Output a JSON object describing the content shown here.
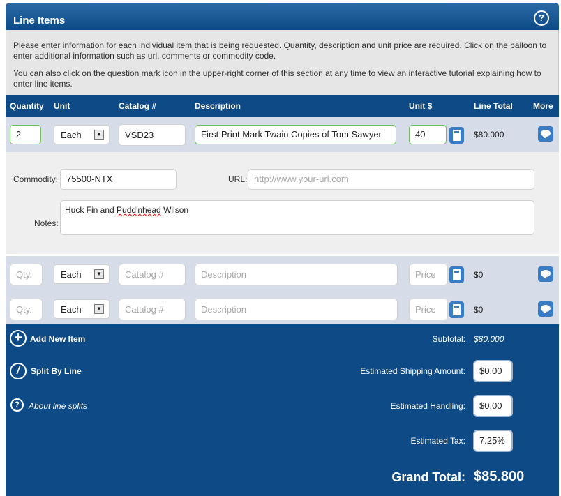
{
  "header": {
    "title": "Line Items",
    "help_icon": "?"
  },
  "intro": {
    "line1": "Please enter information for each individual item that is being requested. Quantity, description and unit price are required. Click on the balloon to enter additional information such as url, comments or commodity code.",
    "line2": "You can also click on the question mark icon in the upper-right corner of this section at any time to view an interactive tutorial explaining how to enter line items."
  },
  "columns": {
    "quantity": "Quantity",
    "unit": "Unit",
    "catalog": "Catalog #",
    "description": "Description",
    "unit_price": "Unit $",
    "line_total": "Line Total",
    "more": "More"
  },
  "items": [
    {
      "quantity": "2",
      "unit": "Each",
      "catalog": "VSD23",
      "description": "First Print Mark Twain Copies of Tom Sawyer",
      "price": "40",
      "line_total": "$80.000"
    },
    {
      "quantity": "",
      "unit": "Each",
      "catalog": "",
      "description": "",
      "price": "",
      "line_total": "$0"
    },
    {
      "quantity": "",
      "unit": "Each",
      "catalog": "",
      "description": "",
      "price": "",
      "line_total": "$0"
    }
  ],
  "placeholders": {
    "quantity": "Qty.",
    "catalog": "Catalog #",
    "description": "Description",
    "price": "Price",
    "url": "http://www.your-url.com"
  },
  "detail": {
    "commodity_label": "Commodity:",
    "commodity_value": "75500-NTX",
    "url_label": "URL:",
    "notes_label": "Notes:",
    "notes_a": "Huck Fin and ",
    "notes_b": "Pudd'nhead",
    "notes_c": " Wilson"
  },
  "footer": {
    "add_item": "Add New Item",
    "split_by_line": "Split By Line",
    "about_splits": "About line splits",
    "subtotal_label": "Subtotal:",
    "subtotal_value": "$80.000",
    "shipping_label": "Estimated Shipping Amount:",
    "shipping_value": "$0.00",
    "handling_label": "Estimated Handling:",
    "handling_value": "$0.00",
    "tax_label": "Estimated Tax:",
    "tax_value": "7.25%",
    "grand_total_label": "Grand Total:",
    "grand_total_value": "$85.800"
  },
  "colors": {
    "panel": "#0d4a86",
    "row": "#d6dde8",
    "accent": "#3a7cc3",
    "valid": "#6cc05a"
  }
}
